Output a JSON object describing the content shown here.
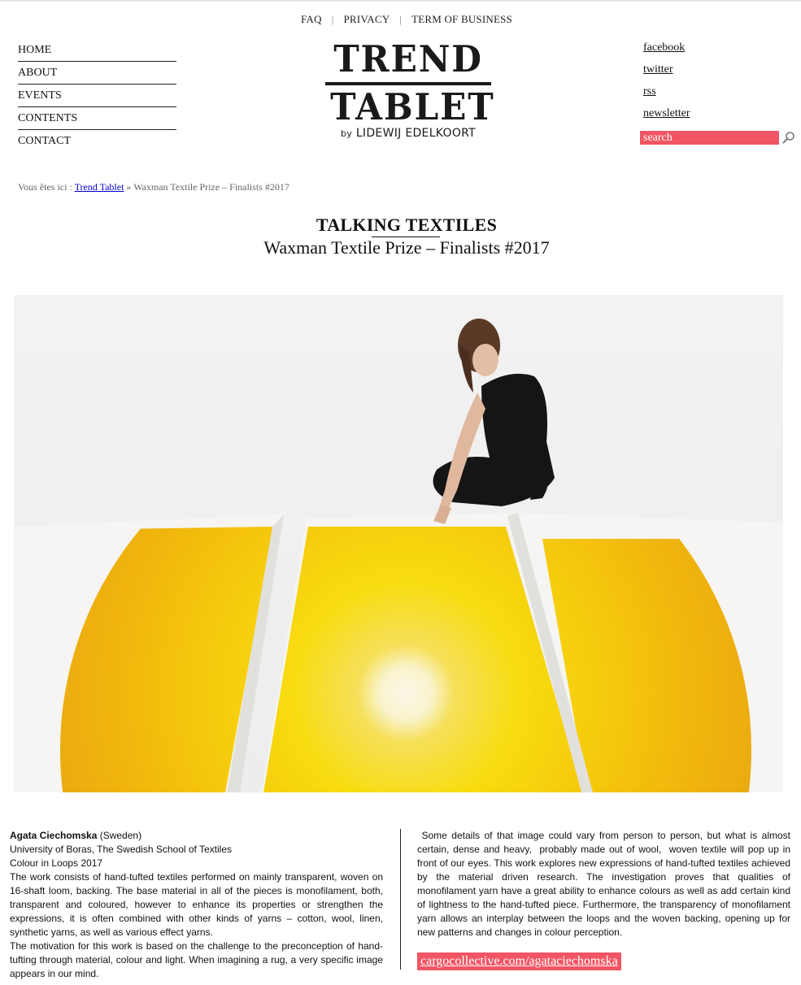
{
  "top_links": [
    {
      "label": "FAQ"
    },
    {
      "label": "PRIVACY"
    },
    {
      "label": "TERM OF BUSINESS"
    }
  ],
  "top_sep": "|",
  "nav": [
    {
      "label": "HOME"
    },
    {
      "label": "ABOUT"
    },
    {
      "label": "EVENTS"
    },
    {
      "label": "CONTENTS"
    },
    {
      "label": "CONTACT"
    }
  ],
  "logo": {
    "line1": "TREND",
    "line2": "TABLET",
    "by": "by",
    "author": "LIDEWIJ EDELKOORT"
  },
  "social": [
    {
      "label": "facebook"
    },
    {
      "label": "twitter"
    },
    {
      "label": "rss"
    },
    {
      "label": "newsletter"
    }
  ],
  "search": {
    "placeholder": "search",
    "icon": "search-icon",
    "color": "#f25564"
  },
  "breadcrumb": {
    "prefix": "Vous êtes ici :",
    "home": "Trend Tablet",
    "sep": "»",
    "current": "Waxman Textile Prize – Finalists #2017"
  },
  "article": {
    "category": "TALKING TEXTILES",
    "title": "Waxman Textile Prize – Finalists #2017",
    "author_name": "Agata Ciechomska",
    "author_country": " (Sweden)",
    "school": "University of Boras, The Swedish School of Textiles",
    "work": "Colour in Loops 2017",
    "para1": "The work consists of hand-tufted textiles performed on mainly transparent, woven on 16-shaft loom, backing. The base material in all of the pieces is monofilament, both, transparent and coloured, however to enhance its properties or strengthen the expressions, it is often combined with other kinds of yarns – cotton, wool, linen, synthetic yarns, as well as various effect yarns.",
    "para2": "The motivation for this work is based on the challenge to the preconception of hand-tufting through material, colour and light.  When imagining a rug, a very specific image appears in our mind.",
    "para3": " Some details of that image could vary from person to person, but what is almost certain, dense and heavy,  probably made out of wool,  woven textile will pop up in front of our eyes. This work explores new expressions of hand-tufted textiles achieved by the material driven research. The investigation proves that qualities of monofilament yarn have a great ability to enhance colours as well as add certain kind of lightness to the hand-tufted piece. Furthermore, the transparency of monofilament yarn allows an interplay between the loops and the woven backing, opening up for new patterns and changes in colour perception.",
    "link": "cargocollective.com/agataciechomska"
  }
}
